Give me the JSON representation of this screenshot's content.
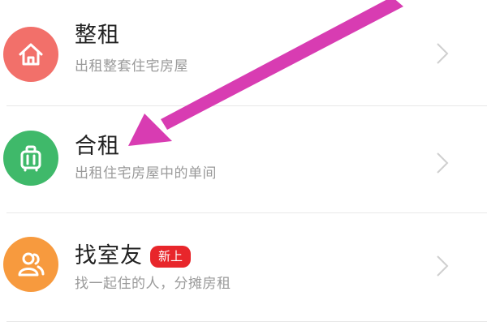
{
  "items": [
    {
      "title": "整租",
      "subtitle": "出租整套住宅房屋",
      "icon": "home-icon",
      "color": "#f2706a"
    },
    {
      "title": "合租",
      "subtitle": "出租住宅房屋中的单间",
      "icon": "luggage-icon",
      "color": "#3fb96a"
    },
    {
      "title": "找室友",
      "subtitle": "找一起住的人，分摊房租",
      "icon": "people-icon",
      "color": "#f79a3e",
      "badge": "新上",
      "badge_color": "#e8262b"
    }
  ],
  "annotation": {
    "arrow_color": "#d83cb2"
  }
}
